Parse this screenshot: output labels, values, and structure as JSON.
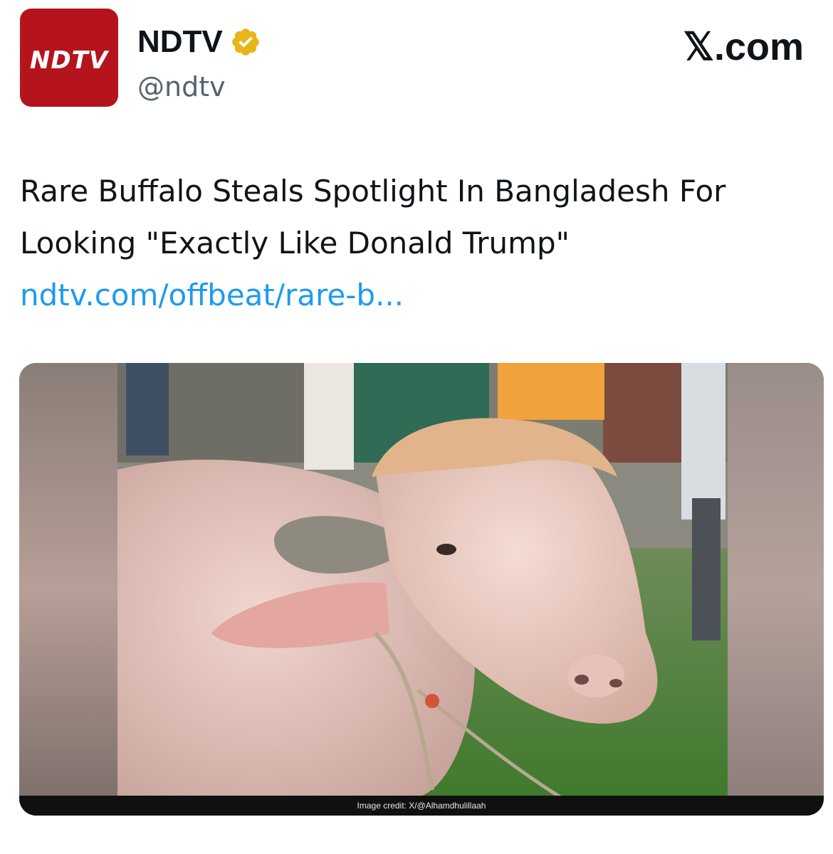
{
  "account": {
    "avatar_text": "NDTV",
    "display_name": "NDTV",
    "handle": "@ndtv",
    "verified_icon": "verified-badge-gold-icon",
    "avatar_color": "#b5141c"
  },
  "site": {
    "brand": "𝕏.com"
  },
  "tweet": {
    "text": "Rare Buffalo Steals Spotlight In Bangladesh For Looking \"Exactly Like Donald Trump\"",
    "link_text": "ndtv.com/offbeat/rare-b...",
    "link_color": "#1d9bf0"
  },
  "media": {
    "caption": "Image credit: X/@Alhamdhulillaah"
  }
}
